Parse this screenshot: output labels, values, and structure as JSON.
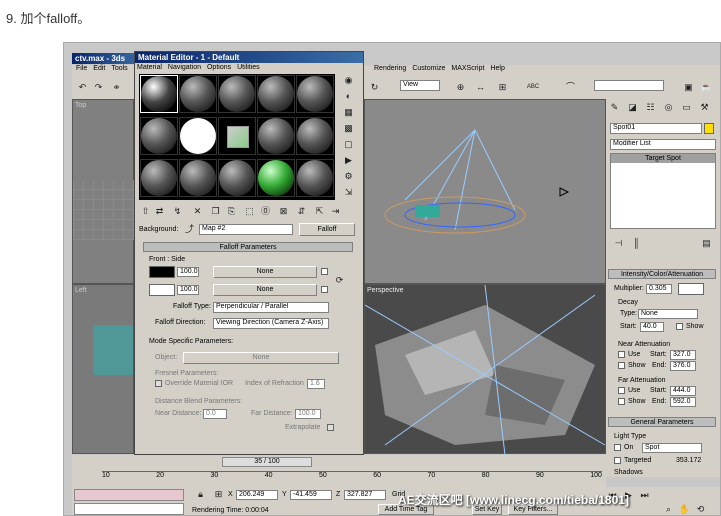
{
  "heading": "9. 加个falloff。",
  "max": {
    "title": "ctv.max - 3ds",
    "menus": [
      "File",
      "Edit",
      "Tools"
    ],
    "menus_right": [
      "Rendering",
      "Customize",
      "MAXScript",
      "Help"
    ],
    "view_select": "View",
    "abc": "ABC"
  },
  "mat": {
    "title": "Material Editor - 1 - Default",
    "menus": [
      "Material",
      "Navigation",
      "Options",
      "Utilities"
    ],
    "background_label": "Background:",
    "map_name": "Map #2",
    "falloff_btn": "Falloff"
  },
  "falloff": {
    "rollout": "Falloff Parameters",
    "front_side": "Front : Side",
    "val1": "100.0",
    "val2": "100.0",
    "none1": "None",
    "none2": "None",
    "type_label": "Falloff Type:",
    "type_value": "Perpendicular / Parallel",
    "dir_label": "Falloff Direction:",
    "dir_value": "Viewing Direction (Camera Z-Axis)"
  },
  "mode": {
    "title": "Mode Specific Parameters:",
    "object_label": "Object:",
    "object_value": "None",
    "fresnel": "Fresnel Parameters:",
    "override": "Override Material IOR",
    "ior_label": "Index of Refraction",
    "ior_value": "1.6",
    "distance": "Distance Blend Parameters:",
    "near_label": "Near Distance:",
    "near_value": "0.0",
    "far_label": "Far Distance:",
    "far_value": "100.0",
    "extrapolate": "Extrapolate"
  },
  "viewports": {
    "top": "Top",
    "left": "Left",
    "persp": "Perspective"
  },
  "cmd": {
    "object_name": "Spot01",
    "modifier_list": "Modifier List",
    "stack_item": "Target Spot",
    "ica": "Intensity/Color/Attenuation",
    "multiplier_label": "Multiplier:",
    "multiplier": "0.305",
    "decay": "Decay",
    "decay_type_label": "Type:",
    "decay_type": "None",
    "decay_start_label": "Start:",
    "decay_start": "40.0",
    "show": "Show",
    "near_att": "Near Attenuation",
    "use": "Use",
    "start": "Start:",
    "end": "End:",
    "near_start": "327.0",
    "near_end": "376.0",
    "far_att": "Far Attenuation",
    "far_start": "444.0",
    "far_end": "592.0",
    "general": "General Parameters",
    "light_type": "Light Type",
    "on": "On",
    "type": "Spot",
    "targeted": "Targeted",
    "targeted_val": "353.172",
    "shadows": "Shadows"
  },
  "timeline": {
    "frame": "35 / 100",
    "ticks": [
      "10",
      "20",
      "30",
      "40",
      "50",
      "60",
      "70",
      "80",
      "90",
      "100"
    ]
  },
  "status": {
    "x": "206.249",
    "y": "-41.459",
    "z": "327.827",
    "grid": "Grid",
    "rendering": "Rendering Time: 0:00:04",
    "add_time_tag": "Add Time Tag",
    "set_key": "Set Key",
    "key_filters": "Key Filters..."
  },
  "watermark": "AE交流区吧 [www.linecg.com/tieba/1801]"
}
